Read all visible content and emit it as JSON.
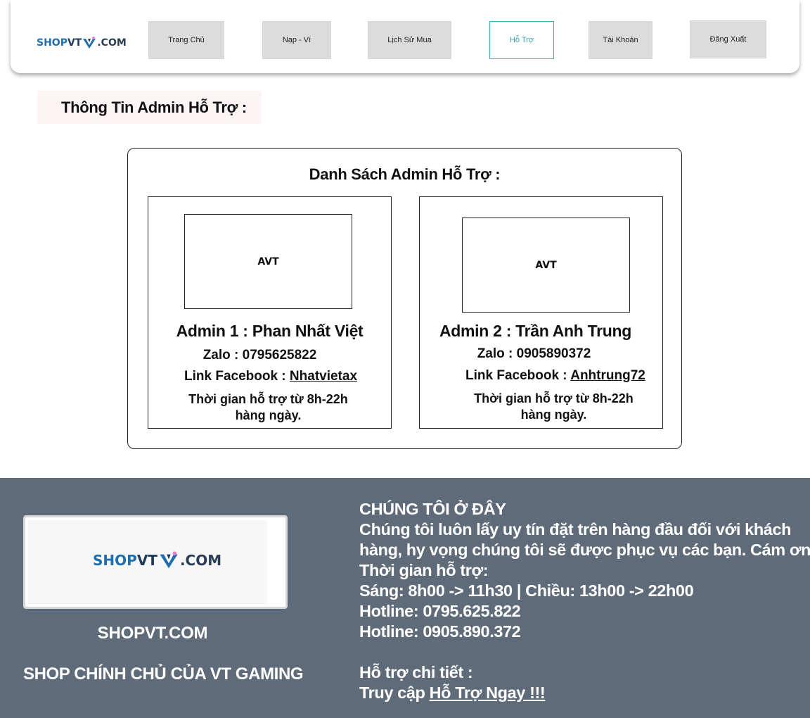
{
  "brand": {
    "shop": "SHOP",
    "vt": "VT",
    "com": ".COM"
  },
  "colors": {
    "footer_bg": "#5f6b78",
    "active_nav": "#3ab0c2",
    "nav_bg": "#dcdcdc"
  },
  "nav": {
    "home": "Trang Chủ",
    "wallet": "Nạp - Ví",
    "history": "Lịch Sử Mua",
    "support": "Hỗ Trợ",
    "account": "Tài Khoản",
    "logout": "Đăng Xuất"
  },
  "section_title": "Thông Tin Admin Hỗ Trợ :",
  "admin_list": {
    "title": "Danh Sách Admin Hỗ Trợ :",
    "admins": [
      {
        "avatar": "AVT",
        "name": "Admin 1 : Phan Nhất Việt",
        "zalo": "Zalo : 0795625822",
        "fb_label": "Link Facebook : ",
        "fb_link": "Nhatvietax",
        "hours_1": "Thời gian hỗ trợ từ 8h-22h",
        "hours_2": "hàng ngày."
      },
      {
        "avatar": "AVT",
        "name": "Admin 2 : Trần Anh Trung",
        "zalo": "Zalo : 0905890372",
        "fb_label": "Link Facebook : ",
        "fb_link": "Anhtrung72",
        "hours_1": "Thời gian hỗ trợ từ 8h-22h",
        "hours_2": "hàng ngày."
      }
    ]
  },
  "footer": {
    "brand": "SHOPVT.COM",
    "slogan": "SHOP CHÍNH CHỦ CỦA VT GAMING",
    "heading": "CHÚNG TÔI Ở ĐÂY",
    "desc_1": "Chúng tôi luôn lấy uy tín đặt trên hàng đầu đối với khách",
    "desc_2": "hàng, hy vọng chúng tôi sẽ được phục vụ các bạn. Cám ơn!",
    "support_time_label": "Thời gian hỗ trợ:",
    "support_time": "Sáng: 8h00 -> 11h30 | Chiều: 13h00 -> 22h00",
    "hotline_1": "Hotline: 0795.625.822",
    "hotline_2": "Hotline: 0905.890.372",
    "detail_label": "Hỗ trợ chi tiết :",
    "access_prefix": "Truy cập ",
    "access_link": "Hỗ Trợ Ngay !!!"
  }
}
